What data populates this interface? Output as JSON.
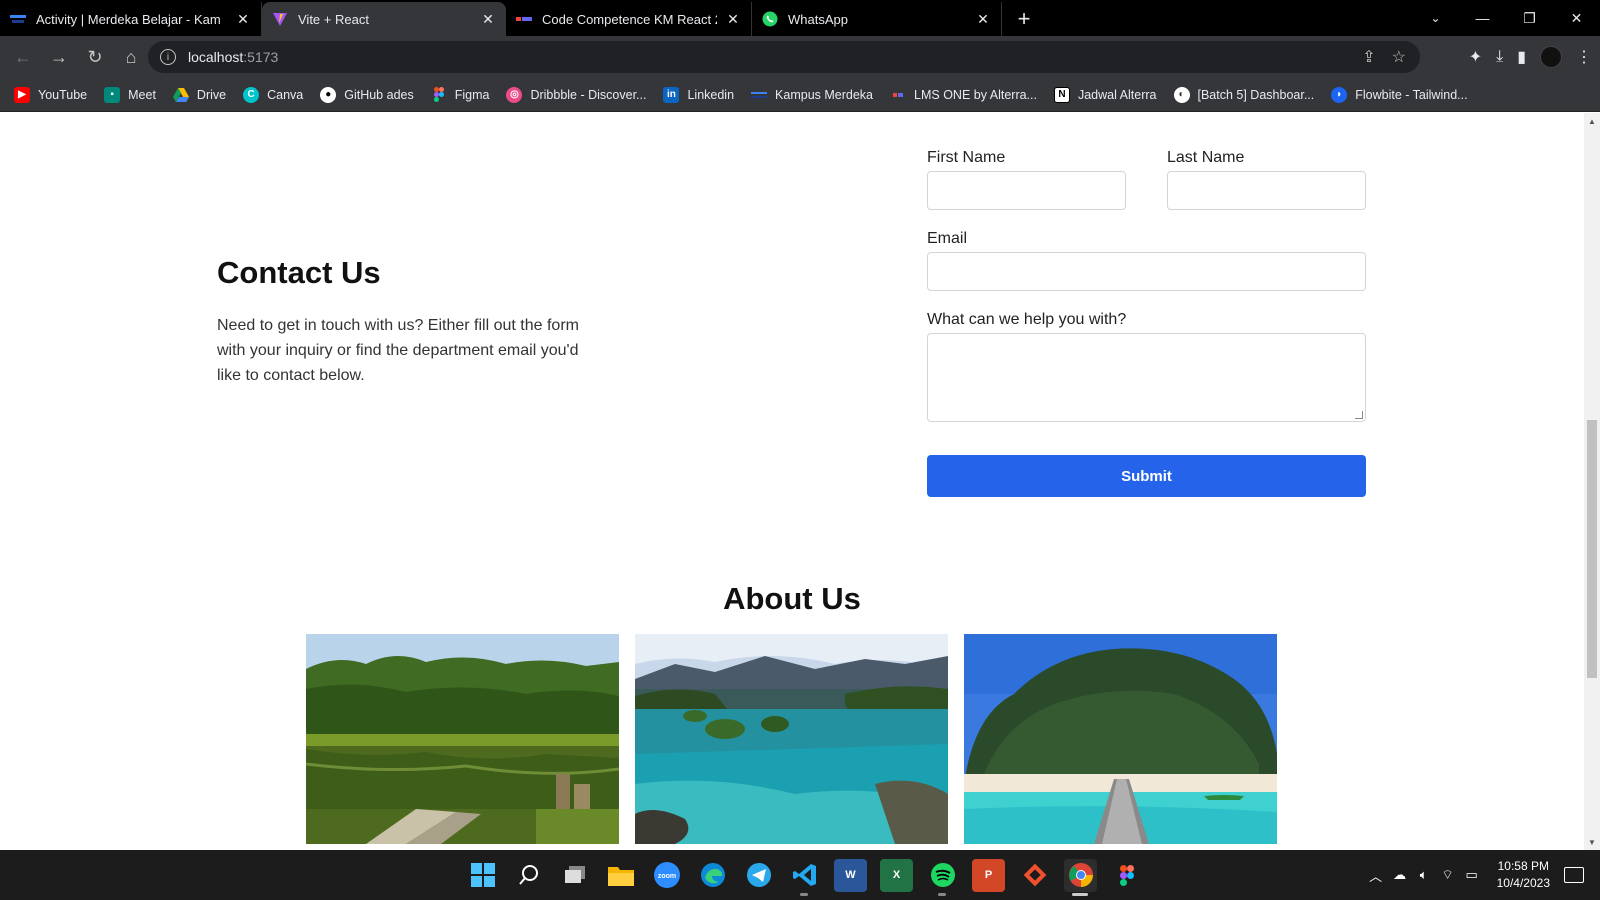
{
  "browser": {
    "tabs": [
      {
        "title": "Activity | Merdeka Belajar - Kam",
        "favicon": "merdeka-icon",
        "active": false
      },
      {
        "title": "Vite + React",
        "favicon": "vite-icon",
        "active": true
      },
      {
        "title": "Code Competence KM React 2 -",
        "favicon": "alterra-icon",
        "active": false
      },
      {
        "title": "WhatsApp",
        "favicon": "whatsapp-icon",
        "active": false
      }
    ],
    "new_tab": "+",
    "address": {
      "host": "localhost",
      "port": ":5173"
    },
    "bookmarks": [
      {
        "label": "YouTube",
        "icon": "youtube-icon",
        "color": "#ff0000"
      },
      {
        "label": "Meet",
        "icon": "meet-icon",
        "color": "#00897b"
      },
      {
        "label": "Drive",
        "icon": "drive-icon",
        "color": "#fbbc04"
      },
      {
        "label": "Canva",
        "icon": "canva-icon",
        "color": "#00c4cc"
      },
      {
        "label": "GitHub ades",
        "icon": "github-icon",
        "color": "#ffffff"
      },
      {
        "label": "Figma",
        "icon": "figma-icon",
        "color": "#f24e1e"
      },
      {
        "label": "Dribbble - Discover...",
        "icon": "dribbble-icon",
        "color": "#ea4c89"
      },
      {
        "label": "Linkedin",
        "icon": "linkedin-icon",
        "color": "#0a66c2"
      },
      {
        "label": "Kampus Merdeka",
        "icon": "merdeka-icon",
        "color": "#1e3a8a"
      },
      {
        "label": "LMS ONE by Alterra...",
        "icon": "alterra-icon",
        "color": "#ef4444"
      },
      {
        "label": "Jadwal Alterra",
        "icon": "notion-icon",
        "color": "#ffffff"
      },
      {
        "label": "[Batch 5] Dashboar...",
        "icon": "globe-icon",
        "color": "#ffffff"
      },
      {
        "label": "Flowbite - Tailwind...",
        "icon": "flowbite-icon",
        "color": "#1c64f2"
      }
    ]
  },
  "contact": {
    "title": "Contact Us",
    "description": "Need to get in touch with us? Either fill out the form with your inquiry or find the department email you'd like to contact below."
  },
  "form": {
    "first_name_label": "First Name",
    "first_name_value": "",
    "last_name_label": "Last Name",
    "last_name_value": "",
    "email_label": "Email",
    "email_value": "",
    "message_label": "What can we help you with?",
    "message_value": "",
    "submit_label": "Submit",
    "submit_color": "#2563eb"
  },
  "about": {
    "title": "About Us",
    "images": [
      {
        "name": "forest-lake-image"
      },
      {
        "name": "bay-islands-image"
      },
      {
        "name": "beach-pier-image"
      }
    ]
  },
  "taskbar": {
    "apps": [
      {
        "name": "windows-start-icon",
        "label": ""
      },
      {
        "name": "search-icon",
        "label": ""
      },
      {
        "name": "task-view-icon",
        "label": ""
      },
      {
        "name": "file-explorer-icon",
        "label": ""
      },
      {
        "name": "zoom-icon",
        "label": "zoom"
      },
      {
        "name": "edge-icon",
        "label": ""
      },
      {
        "name": "telegram-icon",
        "label": ""
      },
      {
        "name": "vscode-icon",
        "label": ""
      },
      {
        "name": "word-icon",
        "label": "W"
      },
      {
        "name": "excel-icon",
        "label": "X"
      },
      {
        "name": "spotify-icon",
        "label": ""
      },
      {
        "name": "powerpoint-icon",
        "label": "P"
      },
      {
        "name": "git-icon",
        "label": ""
      },
      {
        "name": "chrome-icon",
        "label": ""
      },
      {
        "name": "figma-icon",
        "label": ""
      }
    ],
    "time": "10:58 PM",
    "date": "10/4/2023"
  }
}
